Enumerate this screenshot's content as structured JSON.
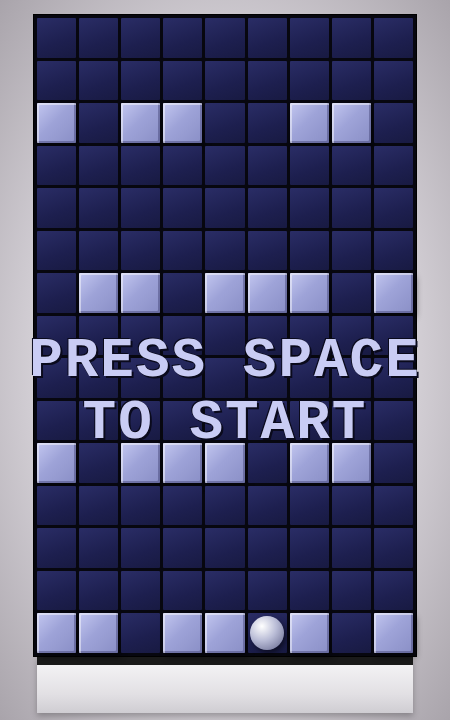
{
  "board": {
    "rows": [
      {
        "cells": [
          {
            "kind": "empty"
          },
          {
            "kind": "empty"
          },
          {
            "kind": "empty"
          },
          {
            "kind": "empty"
          },
          {
            "kind": "empty"
          },
          {
            "kind": "empty"
          },
          {
            "kind": "empty"
          },
          {
            "kind": "empty"
          },
          {
            "kind": "empty"
          }
        ]
      },
      {
        "cells": [
          {
            "kind": "empty"
          },
          {
            "kind": "empty"
          },
          {
            "kind": "empty"
          },
          {
            "kind": "empty"
          },
          {
            "kind": "empty"
          },
          {
            "kind": "empty"
          },
          {
            "kind": "empty"
          },
          {
            "kind": "empty"
          },
          {
            "kind": "empty"
          }
        ]
      },
      {
        "cells": [
          {
            "kind": "brick"
          },
          {
            "kind": "empty"
          },
          {
            "kind": "brick"
          },
          {
            "kind": "brick"
          },
          {
            "kind": "empty"
          },
          {
            "kind": "empty"
          },
          {
            "kind": "brick"
          },
          {
            "kind": "brick"
          },
          {
            "kind": "empty"
          }
        ]
      },
      {
        "cells": [
          {
            "kind": "empty"
          },
          {
            "kind": "empty"
          },
          {
            "kind": "empty"
          },
          {
            "kind": "empty"
          },
          {
            "kind": "empty"
          },
          {
            "kind": "empty"
          },
          {
            "kind": "empty"
          },
          {
            "kind": "empty"
          },
          {
            "kind": "empty"
          }
        ]
      },
      {
        "cells": [
          {
            "kind": "empty"
          },
          {
            "kind": "empty"
          },
          {
            "kind": "empty"
          },
          {
            "kind": "empty"
          },
          {
            "kind": "empty"
          },
          {
            "kind": "empty"
          },
          {
            "kind": "empty"
          },
          {
            "kind": "empty"
          },
          {
            "kind": "empty"
          }
        ]
      },
      {
        "cells": [
          {
            "kind": "empty"
          },
          {
            "kind": "empty"
          },
          {
            "kind": "empty"
          },
          {
            "kind": "empty"
          },
          {
            "kind": "empty"
          },
          {
            "kind": "empty"
          },
          {
            "kind": "empty"
          },
          {
            "kind": "empty"
          },
          {
            "kind": "empty"
          }
        ]
      },
      {
        "cells": [
          {
            "kind": "empty"
          },
          {
            "kind": "brick"
          },
          {
            "kind": "brick"
          },
          {
            "kind": "empty"
          },
          {
            "kind": "brick"
          },
          {
            "kind": "brick"
          },
          {
            "kind": "brick"
          },
          {
            "kind": "empty"
          },
          {
            "kind": "brick"
          }
        ]
      },
      {
        "cells": [
          {
            "kind": "empty"
          },
          {
            "kind": "empty"
          },
          {
            "kind": "empty"
          },
          {
            "kind": "empty"
          },
          {
            "kind": "empty"
          },
          {
            "kind": "empty"
          },
          {
            "kind": "empty"
          },
          {
            "kind": "empty"
          },
          {
            "kind": "empty"
          }
        ]
      },
      {
        "cells": [
          {
            "kind": "empty"
          },
          {
            "kind": "empty"
          },
          {
            "kind": "empty"
          },
          {
            "kind": "empty"
          },
          {
            "kind": "empty"
          },
          {
            "kind": "empty"
          },
          {
            "kind": "empty"
          },
          {
            "kind": "empty"
          },
          {
            "kind": "empty"
          }
        ]
      },
      {
        "cells": [
          {
            "kind": "empty"
          },
          {
            "kind": "empty"
          },
          {
            "kind": "empty"
          },
          {
            "kind": "empty"
          },
          {
            "kind": "empty"
          },
          {
            "kind": "empty"
          },
          {
            "kind": "empty"
          },
          {
            "kind": "empty"
          },
          {
            "kind": "empty"
          }
        ]
      },
      {
        "cells": [
          {
            "kind": "brick"
          },
          {
            "kind": "empty"
          },
          {
            "kind": "brick"
          },
          {
            "kind": "brick"
          },
          {
            "kind": "brick"
          },
          {
            "kind": "empty"
          },
          {
            "kind": "brick"
          },
          {
            "kind": "brick"
          },
          {
            "kind": "empty"
          }
        ]
      },
      {
        "cells": [
          {
            "kind": "empty"
          },
          {
            "kind": "empty"
          },
          {
            "kind": "empty"
          },
          {
            "kind": "empty"
          },
          {
            "kind": "empty"
          },
          {
            "kind": "empty"
          },
          {
            "kind": "empty"
          },
          {
            "kind": "empty"
          },
          {
            "kind": "empty"
          }
        ]
      },
      {
        "cells": [
          {
            "kind": "empty"
          },
          {
            "kind": "empty"
          },
          {
            "kind": "empty"
          },
          {
            "kind": "empty"
          },
          {
            "kind": "empty"
          },
          {
            "kind": "empty"
          },
          {
            "kind": "empty"
          },
          {
            "kind": "empty"
          },
          {
            "kind": "empty"
          }
        ]
      },
      {
        "cells": [
          {
            "kind": "empty"
          },
          {
            "kind": "empty"
          },
          {
            "kind": "empty"
          },
          {
            "kind": "empty"
          },
          {
            "kind": "empty"
          },
          {
            "kind": "empty"
          },
          {
            "kind": "empty"
          },
          {
            "kind": "empty"
          },
          {
            "kind": "empty"
          }
        ]
      },
      {
        "cells": [
          {
            "kind": "brick"
          },
          {
            "kind": "brick"
          },
          {
            "kind": "empty"
          },
          {
            "kind": "brick"
          },
          {
            "kind": "brick"
          },
          {
            "kind": "ball"
          },
          {
            "kind": "brick"
          },
          {
            "kind": "empty"
          },
          {
            "kind": "brick"
          }
        ]
      }
    ]
  },
  "message": {
    "lines": [
      "PRESS SPACE",
      "TO START"
    ]
  }
}
